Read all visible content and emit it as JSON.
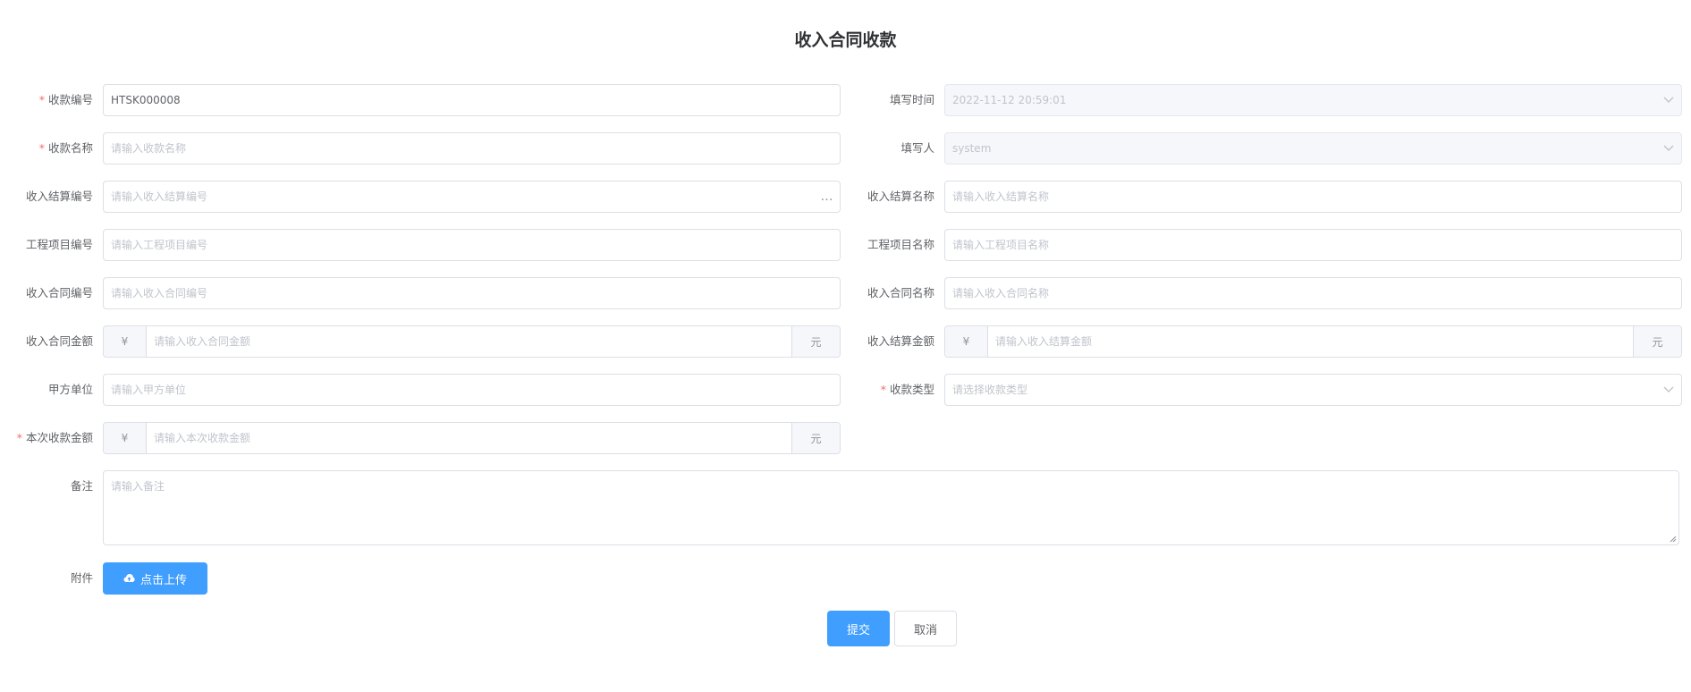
{
  "page": {
    "title": "收入合同收款"
  },
  "form": {
    "receipt_no": {
      "label": "收款编号",
      "value": "HTSK000008",
      "placeholder": "",
      "required_mark": "*"
    },
    "fill_time": {
      "label": "填写时间",
      "value": "2022-11-12 20:59:01"
    },
    "receipt_name": {
      "label": "收款名称",
      "placeholder": "请输入收款名称",
      "required_mark": "*"
    },
    "filler": {
      "label": "填写人",
      "value": "system"
    },
    "settlement_no": {
      "label": "收入结算编号",
      "placeholder": "请输入收入结算编号",
      "more_icon": "…"
    },
    "settlement_name": {
      "label": "收入结算名称",
      "placeholder": "请输入收入结算名称"
    },
    "project_no": {
      "label": "工程项目编号",
      "placeholder": "请输入工程项目编号"
    },
    "project_name": {
      "label": "工程项目名称",
      "placeholder": "请输入工程项目名称"
    },
    "contract_no": {
      "label": "收入合同编号",
      "placeholder": "请输入收入合同编号"
    },
    "contract_name": {
      "label": "收入合同名称",
      "placeholder": "请输入收入合同名称"
    },
    "contract_amount": {
      "label": "收入合同金额",
      "prefix": "¥",
      "placeholder": "请输入收入合同金额",
      "suffix": "元"
    },
    "settlement_amount": {
      "label": "收入结算金额",
      "prefix": "¥",
      "placeholder": "请输入收入结算金额",
      "suffix": "元"
    },
    "party_a": {
      "label": "甲方单位",
      "placeholder": "请输入甲方单位"
    },
    "receipt_type": {
      "label": "收款类型",
      "placeholder": "请选择收款类型",
      "required_mark": "*"
    },
    "current_amount": {
      "label": "本次收款金额",
      "prefix": "¥",
      "placeholder": "请输入本次收款金额",
      "suffix": "元",
      "required_mark": "*"
    },
    "remark": {
      "label": "备注",
      "placeholder": "请输入备注"
    },
    "attachment": {
      "label": "附件",
      "upload_label": "点击上传"
    }
  },
  "actions": {
    "submit_label": "提交",
    "cancel_label": "取消"
  },
  "icons": {
    "chevron": "chevron-down-icon",
    "upload": "cloud-upload-icon",
    "more": "more-dots-icon"
  },
  "colors": {
    "primary": "#409eff",
    "required": "#f56c6c"
  }
}
